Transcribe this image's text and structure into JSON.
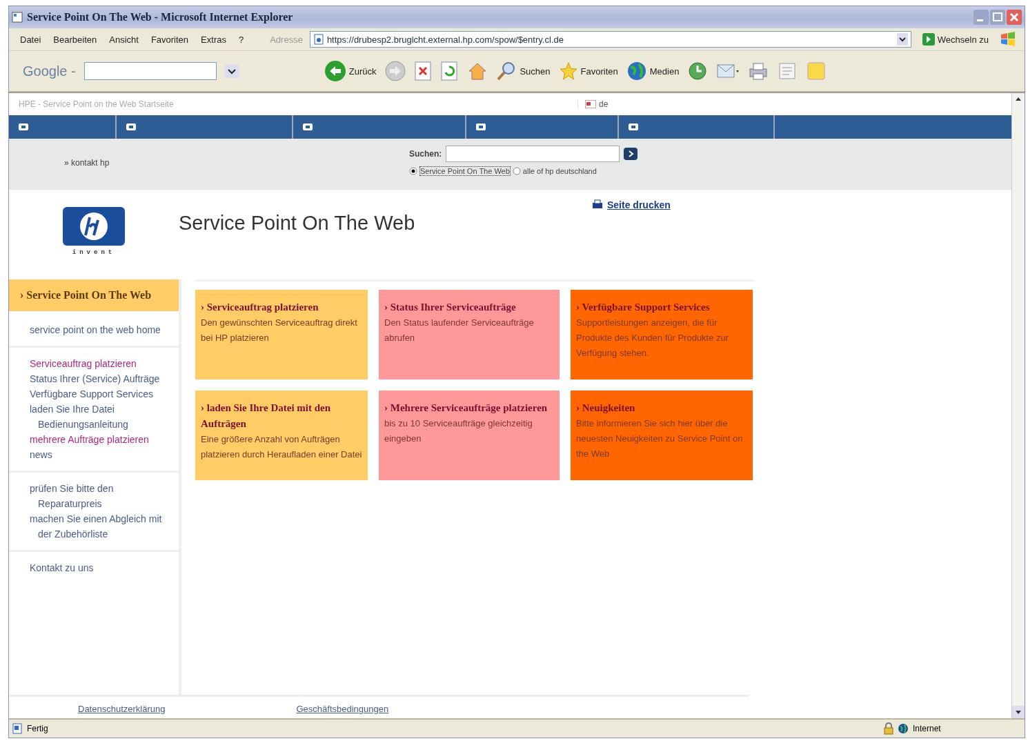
{
  "window": {
    "title": "Service Point On The Web - Microsoft Internet Explorer"
  },
  "menu": [
    "Datei",
    "Bearbeiten",
    "Ansicht",
    "Favoriten",
    "Extras",
    "?"
  ],
  "address": {
    "label": "Adresse",
    "url": "https://drubesp2.bruglcht.external.hp.com/spow/$entry.cl.de",
    "go": "Wechseln zu"
  },
  "toolbar": {
    "google": "Google -",
    "back": "Zurück",
    "search": "Suchen",
    "favorites": "Favoriten",
    "media": "Medien"
  },
  "page": {
    "breadcrumb": "HPE - Service Point on the Web Startseite",
    "language": "de",
    "contact": "» kontakt hp",
    "search_label": "Suchen:",
    "search_scope": [
      {
        "label": "Service Point On The Web",
        "selected": true
      },
      {
        "label": "alle of hp deutschland",
        "selected": false
      }
    ],
    "print": "Seite drucken",
    "logo_tagline": "invent",
    "heading": "Service Point On The Web",
    "sidebar": {
      "title": "› Service Point On The Web",
      "groups": [
        [
          {
            "label": "service point on the web home",
            "visited": false,
            "kind": "link"
          }
        ],
        [
          {
            "label": "Serviceauftrag platzieren",
            "visited": true,
            "kind": "link"
          },
          {
            "label": "Status Ihrer (Service) Aufträge",
            "visited": false,
            "kind": "link"
          },
          {
            "label": "Verfügbare Support Services",
            "visited": false,
            "kind": "link"
          },
          {
            "label": "laden Sie Ihre Datei",
            "visited": false,
            "kind": "link"
          },
          {
            "label": "Bedienungsanleitung",
            "visited": false,
            "kind": "sub"
          },
          {
            "label": "mehrere Aufträge platzieren",
            "visited": true,
            "kind": "link"
          },
          {
            "label": "news",
            "visited": false,
            "kind": "link"
          }
        ],
        [
          {
            "label": "prüfen Sie bitte den Reparaturpreis",
            "visited": false,
            "kind": "link"
          },
          {
            "label": "machen Sie einen Abgleich mit der Zubehörliste",
            "visited": false,
            "kind": "link"
          }
        ],
        [
          {
            "label": "Kontakt zu uns",
            "visited": false,
            "kind": "link"
          }
        ]
      ]
    },
    "cards": [
      {
        "title": "› Serviceauftrag platzieren",
        "text": "Den gewünschten Serviceauftrag direkt bei HP platzieren",
        "color": "#ffcc66"
      },
      {
        "title": "› Status Ihrer Serviceaufträge",
        "text": "Den Status laufender Serviceaufträge abrufen",
        "color": "#ff9999"
      },
      {
        "title": "› Verfügbare Support Services",
        "text": "Supportleistungen anzeigen, die für Produkte des Kunden für Produkte zur Verfügung stehen.",
        "color": "#ff6600"
      },
      {
        "title": "› laden Sie Ihre Datei mit den Aufträgen",
        "text": "Eine größere Anzahl von Aufträgen platzieren durch Heraufladen einer Datei",
        "color": "#ffcc66"
      },
      {
        "title": "› Mehrere Serviceaufträge platzieren",
        "text": "bis zu 10 Serviceaufträge gleichzeitig eingeben",
        "color": "#ff9999"
      },
      {
        "title": "› Neuigkeiten",
        "text": "Bitte informieren Sie sich hier über die neuesten Neuigkeiten zu Service Point on the Web",
        "color": "#ff6600"
      }
    ],
    "footer_links": [
      "Datenschutzerklärung",
      "Geschäftsbedingungen"
    ]
  },
  "status_bar": {
    "text": "Fertig",
    "zone": "Internet"
  }
}
